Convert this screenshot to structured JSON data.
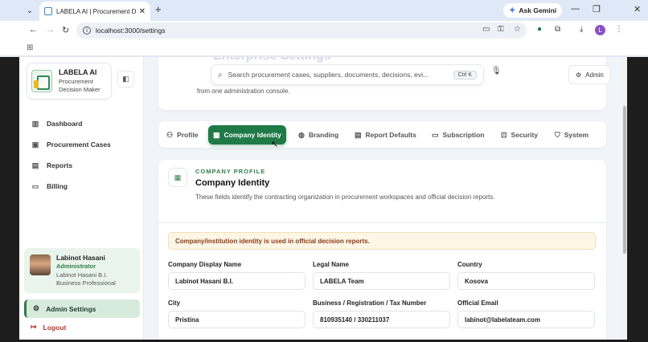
{
  "browser": {
    "tab_title": "LABELA AI | Procurement Decis",
    "url": "localhost:3000/settings",
    "gemini_label": "Ask Gemini",
    "profile_initial": "L"
  },
  "sidebar": {
    "brand_name": "LABELA AI",
    "brand_sub": "Procurement Decision Maker",
    "items": [
      {
        "label": "Dashboard",
        "icon": "bar-chart-icon"
      },
      {
        "label": "Procurement Cases",
        "icon": "briefcase-icon"
      },
      {
        "label": "Reports",
        "icon": "document-icon"
      },
      {
        "label": "Billing",
        "icon": "credit-card-icon"
      }
    ],
    "user": {
      "name": "Labinot Hasani",
      "role": "Administrator",
      "company": "Labinot Hasani B.I.",
      "plan": "Business Professional"
    },
    "admin_settings": "Admin Settings",
    "logout": "Logout"
  },
  "header": {
    "ghost_title": "Enterprise Settings",
    "description": "from one administration console.",
    "search_placeholder": "Search procurement cases, suppliers, documents, decisions, evi...",
    "shortcut": "Ctrl K",
    "admin_chip": "Admin"
  },
  "tabs": [
    {
      "label": "Profile",
      "icon": "user-icon"
    },
    {
      "label": "Company Identity",
      "icon": "building-icon"
    },
    {
      "label": "Branding",
      "icon": "palette-icon"
    },
    {
      "label": "Report Defaults",
      "icon": "document-icon"
    },
    {
      "label": "Subscription",
      "icon": "credit-card-icon"
    },
    {
      "label": "Security",
      "icon": "lock-icon"
    },
    {
      "label": "System",
      "icon": "shield-icon"
    }
  ],
  "section": {
    "eyebrow": "COMPANY PROFILE",
    "title": "Company Identity",
    "description": "These fields identify the contracting organization in procurement workspaces and official decision reports.",
    "notice": "Company/institution identity is used in official decision reports."
  },
  "fields": [
    {
      "label": "Company Display Name",
      "value": "Labinot Hasani B.I."
    },
    {
      "label": "Legal Name",
      "value": "LABELA Team"
    },
    {
      "label": "Country",
      "value": "Kosova"
    },
    {
      "label": "City",
      "value": "Pristina"
    },
    {
      "label": "Business / Registration / Tax Number",
      "value": "810935140 / 330211037"
    },
    {
      "label": "Official Email",
      "value": "labinot@labelateam.com"
    }
  ],
  "colors": {
    "accent": "#1f7a47",
    "notice_bg": "#fdf6e7",
    "logout": "#b33a2a"
  }
}
